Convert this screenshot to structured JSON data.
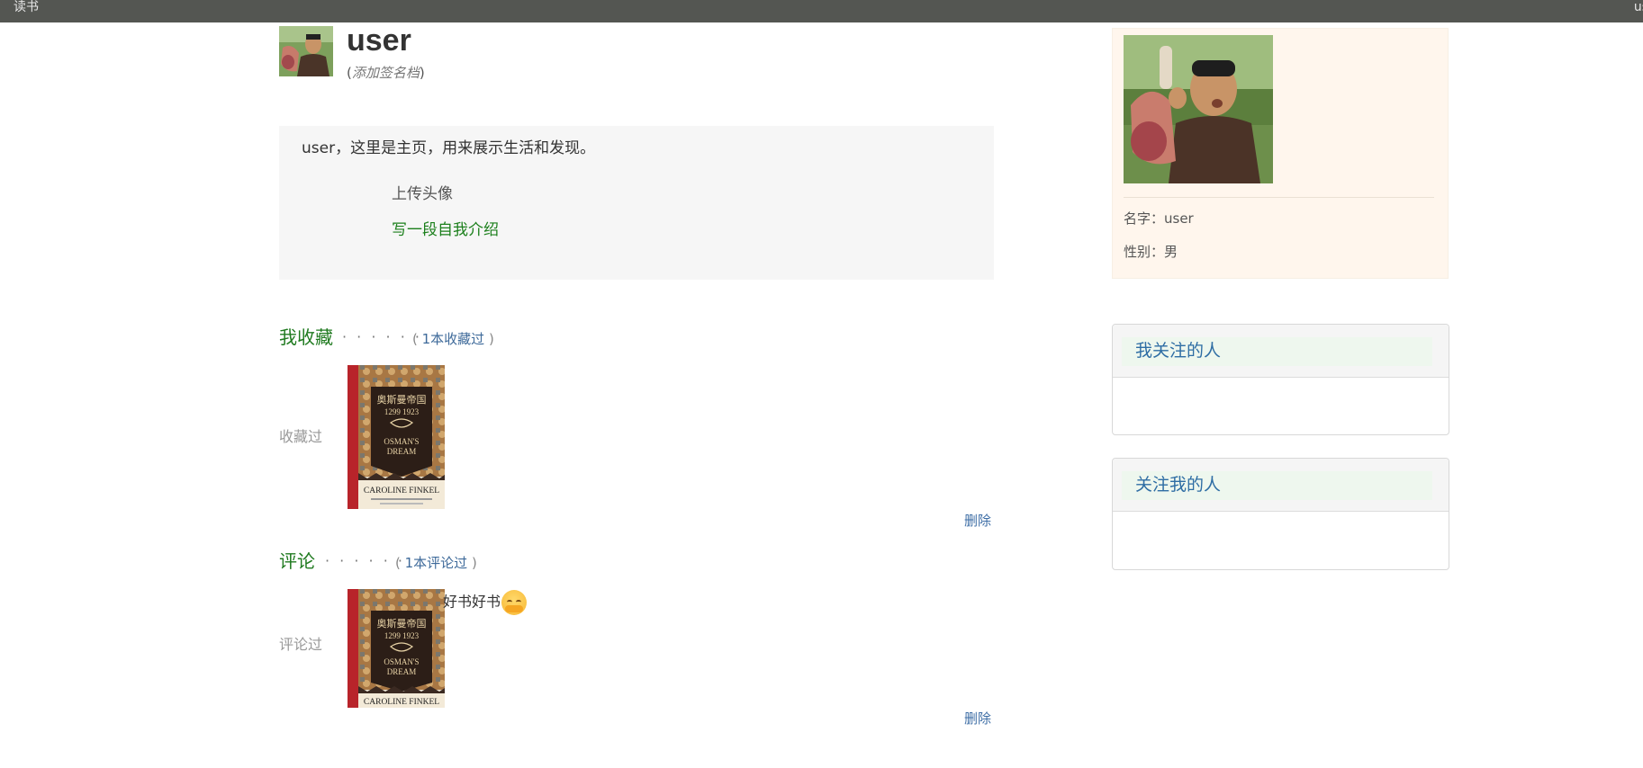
{
  "topbar": {
    "brand": "读书",
    "user_link": "us"
  },
  "profile": {
    "username": "user",
    "signature_open": "(",
    "signature": "添加签名档",
    "signature_close": ")"
  },
  "intro": {
    "text": "user，这里是主页，用来展示生活和发现。",
    "upload_avatar": "上传头像",
    "write_intro": "写一段自我介绍"
  },
  "collections": {
    "title": "我收藏",
    "dots": "· · · · · ·",
    "count_open": "(",
    "count": "1本收藏过",
    "count_close": ")",
    "row_label": "收藏过",
    "delete": "删除"
  },
  "reviews": {
    "title": "评论",
    "dots": "· · · · · ·",
    "count_open": "(",
    "count": "1本评论过",
    "count_close": ")",
    "row_label": "评论过",
    "comment": "好书好书",
    "delete": "删除"
  },
  "book": {
    "title_cn": "奥斯曼帝国",
    "years": "1299  1923",
    "title_en_1": "OSMAN'S",
    "title_en_2": "DREAM",
    "author": "CAROLINE FINKEL",
    "spine": "OSMAN'S DREAM  CAROLINE FINKEL"
  },
  "sidebar": {
    "name_label": "名字：user",
    "gender_label": "性别：男",
    "following_title": "我关注的人",
    "followers_title": "关注我的人"
  },
  "icons": {
    "emoji": "hugging-face-emoji"
  }
}
